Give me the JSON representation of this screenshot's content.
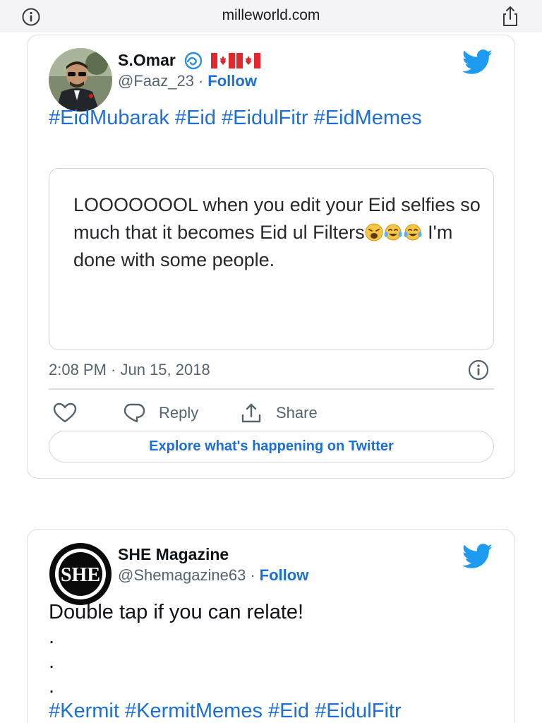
{
  "browser": {
    "url": "milleworld.com",
    "icons": {
      "left": "info-icon",
      "right": "share-icon"
    }
  },
  "tweet1": {
    "author_name": "S.Omar",
    "author_extras": [
      "wave-emoji",
      "canada-flag",
      "canada-flag"
    ],
    "handle": "@Faaz_23",
    "separator": "·",
    "follow": "Follow",
    "hashtags": "#EidMubarak #Eid #EidulFitr #EidMemes",
    "quote": {
      "text_before": "LOOOOOOOL when you edit your Eid selfies so much that it becomes Eid ul Filters",
      "emojis": [
        "weary-face",
        "tears-of-joy",
        "tears-of-joy"
      ],
      "text_after": " I'm done with some people."
    },
    "timestamp": "2:08 PM · Jun 15, 2018",
    "actions": {
      "reply": "Reply",
      "share": "Share"
    },
    "explore": "Explore what's happening on Twitter"
  },
  "tweet2": {
    "author_name": "SHE Magazine",
    "logo_text": "SHE",
    "handle": "@Shemagazine63",
    "separator": "·",
    "follow": "Follow",
    "text": "Double tap if you can relate!",
    "dots": [
      ".",
      ".",
      "."
    ],
    "hashtags": "#Kermit #KermitMemes #Eid #EidulFitr"
  },
  "colors": {
    "link_blue": "#1d6fd8",
    "twitter_blue": "#1d9bf0",
    "muted_text": "#536471",
    "border": "#d9dde1"
  }
}
